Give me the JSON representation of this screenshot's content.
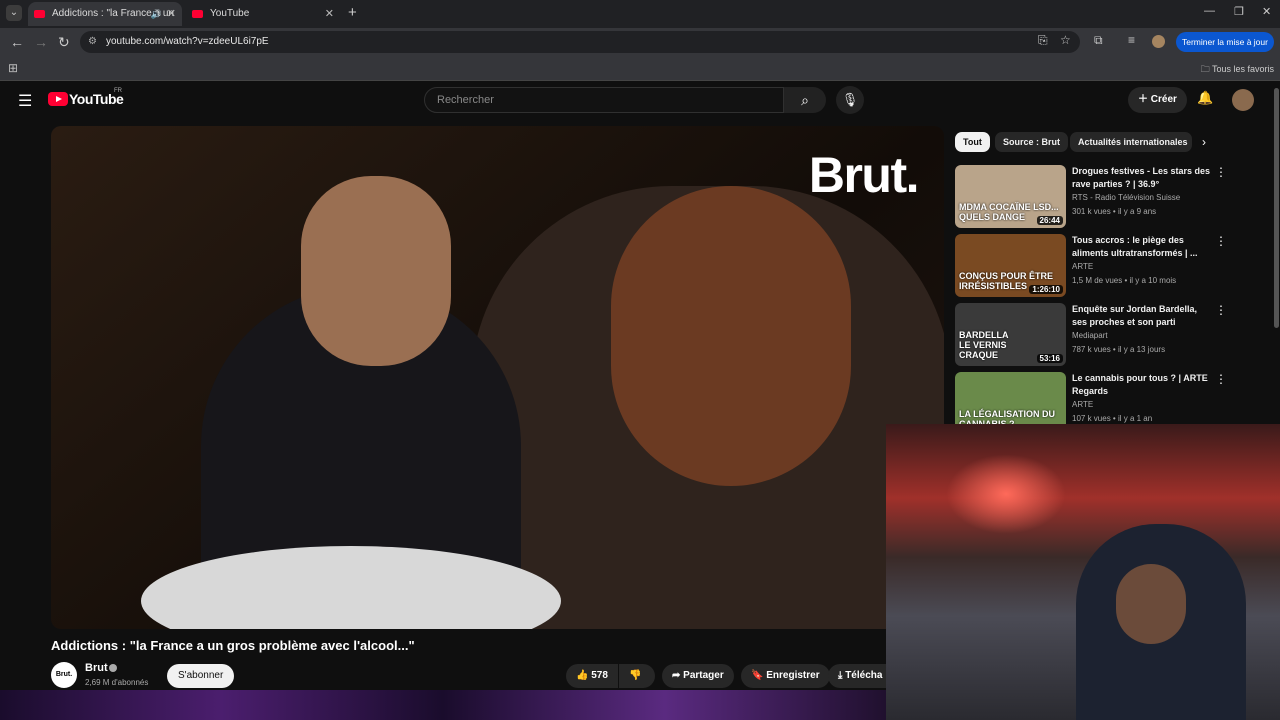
{
  "browser": {
    "tabs": [
      {
        "title": "Addictions : \"la France a un",
        "active": true,
        "audio_icon": "speaker-icon"
      },
      {
        "title": "YouTube",
        "active": false
      }
    ],
    "url": "youtube.com/watch?v=zdeeUL6i7pE",
    "update_button": "Terminer la mise à jour",
    "bookmarks_label": "Tous les favoris"
  },
  "youtube": {
    "logo_text": "YouTube",
    "country_code": "FR",
    "search_placeholder": "Rechercher",
    "create_label": "Créer"
  },
  "video": {
    "overlay_brand": "Brut.",
    "title": "Addictions : \"la France a un gros problème avec l'alcool...\"",
    "channel": {
      "name": "Brut",
      "logo_text": "Brut.",
      "subscribers": "2,69 M d'abonnés"
    },
    "subscribe_label": "S'abonner",
    "likes": "578",
    "share_label": "Partager",
    "save_label": "Enregistrer",
    "download_label": "Télécha"
  },
  "chips": [
    "Tout",
    "Source : Brut",
    "Actualités internationales"
  ],
  "recommendations": [
    {
      "title": "Drogues festives - Les stars des rave parties ? | 36.9°",
      "channel": "RTS - Radio Télévision Suisse",
      "meta": "301 k vues • il y a 9 ans",
      "duration": "26:44",
      "thumb_text": "MDMA COCAÏNE LSD... QUELS DANGE",
      "thumb_color": "#b9a48a"
    },
    {
      "title": "Tous accros : le piège des aliments ultratransformés | ...",
      "channel": "ARTE",
      "meta": "1,5 M de vues • il y a 10 mois",
      "duration": "1:26:10",
      "thumb_text": "CONÇUS POUR ÊTRE IRRÉSISTIBLES",
      "thumb_color": "#7a4a22"
    },
    {
      "title": "Enquête sur Jordan Bardella, ses proches et son parti",
      "channel": "Mediapart",
      "meta": "787 k vues • il y a 13 jours",
      "duration": "53:16",
      "thumb_text": "BARDELLA LE VERNIS CRAQUE",
      "thumb_color": "#3a3a3a"
    },
    {
      "title": "Le cannabis pour tous ? | ARTE Regards",
      "channel": "ARTE",
      "meta": "107 k vues • il y a 1 an",
      "duration": "",
      "thumb_text": "LA LÉGALISATION DU CANNABIS ?",
      "thumb_color": "#6a8a4a"
    }
  ]
}
